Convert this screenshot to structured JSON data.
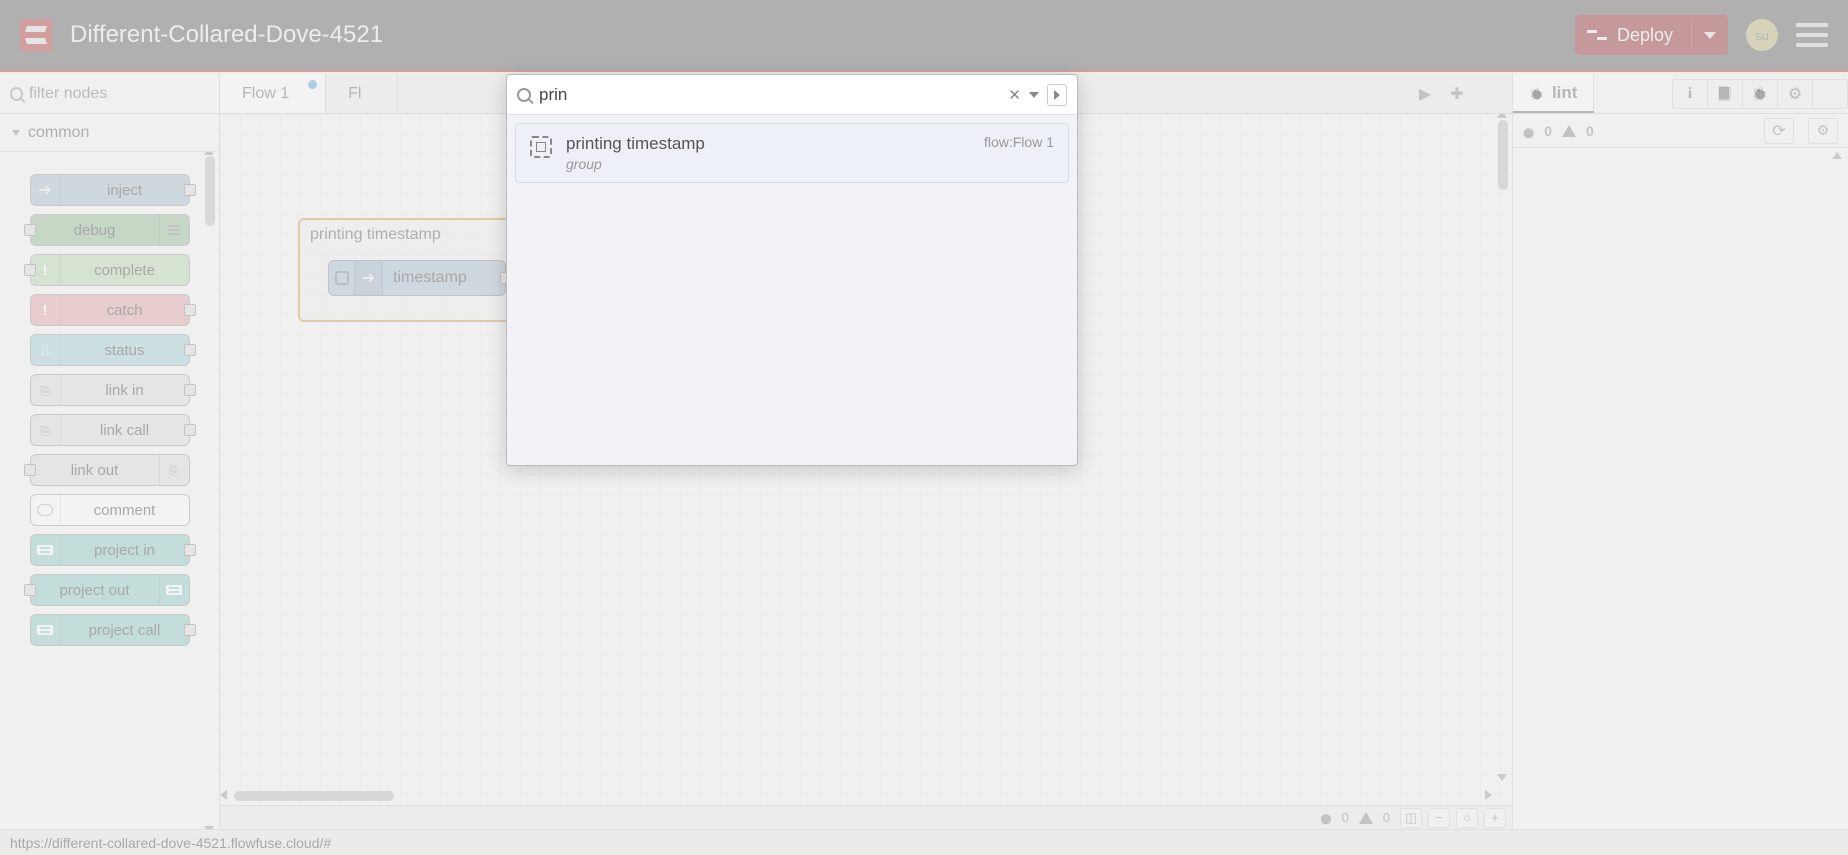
{
  "header": {
    "title": "Different-Collared-Dove-4521",
    "deploy_label": "Deploy",
    "user_initials": "su"
  },
  "palette": {
    "filter_placeholder": "filter nodes",
    "category": "common",
    "nodes": [
      {
        "label": "inject",
        "color": "c-inject",
        "port_side": "right",
        "icon_side": "left",
        "icon": "arrow"
      },
      {
        "label": "debug",
        "color": "c-debug",
        "port_side": "left",
        "icon_side": "right",
        "icon": "list"
      },
      {
        "label": "complete",
        "color": "c-complete",
        "port_side": "left",
        "icon_side": "left",
        "icon": "excl"
      },
      {
        "label": "catch",
        "color": "c-catch",
        "port_side": "right",
        "icon_side": "left",
        "icon": "excl"
      },
      {
        "label": "status",
        "color": "c-status",
        "port_side": "right",
        "icon_side": "left",
        "icon": "pulse"
      },
      {
        "label": "link in",
        "color": "c-link",
        "port_side": "right",
        "icon_side": "left",
        "icon": "link"
      },
      {
        "label": "link call",
        "color": "c-link",
        "port_side": "right",
        "icon_side": "left",
        "icon": "link"
      },
      {
        "label": "link out",
        "color": "c-link",
        "port_side": "left",
        "icon_side": "right",
        "icon": "link"
      },
      {
        "label": "comment",
        "color": "c-comment",
        "port_side": "none",
        "icon_side": "left",
        "icon": "comment"
      },
      {
        "label": "project in",
        "color": "c-project",
        "port_side": "right",
        "icon_side": "left",
        "icon": "proj"
      },
      {
        "label": "project out",
        "color": "c-project",
        "port_side": "left",
        "icon_side": "right",
        "icon": "proj"
      },
      {
        "label": "project call",
        "color": "c-project",
        "port_side": "right",
        "icon_side": "left",
        "icon": "proj"
      }
    ]
  },
  "workspace": {
    "tabs": [
      {
        "label": "Flow 1",
        "active": true,
        "unsaved": true
      },
      {
        "label": "Fl",
        "active": false,
        "unsaved": false
      }
    ],
    "group": {
      "title": "printing timestamp",
      "node_label": "timestamp"
    },
    "footer": {
      "errors": "0",
      "warnings": "0"
    }
  },
  "sidebar": {
    "active_tab": "lint",
    "errors": "0",
    "warnings": "0"
  },
  "search": {
    "query": "prin",
    "results": [
      {
        "title": "printing timestamp",
        "subtitle": "group",
        "meta": "flow:Flow 1"
      }
    ]
  },
  "status_bar": {
    "url": "https://different-collared-dove-4521.flowfuse.cloud/#"
  }
}
